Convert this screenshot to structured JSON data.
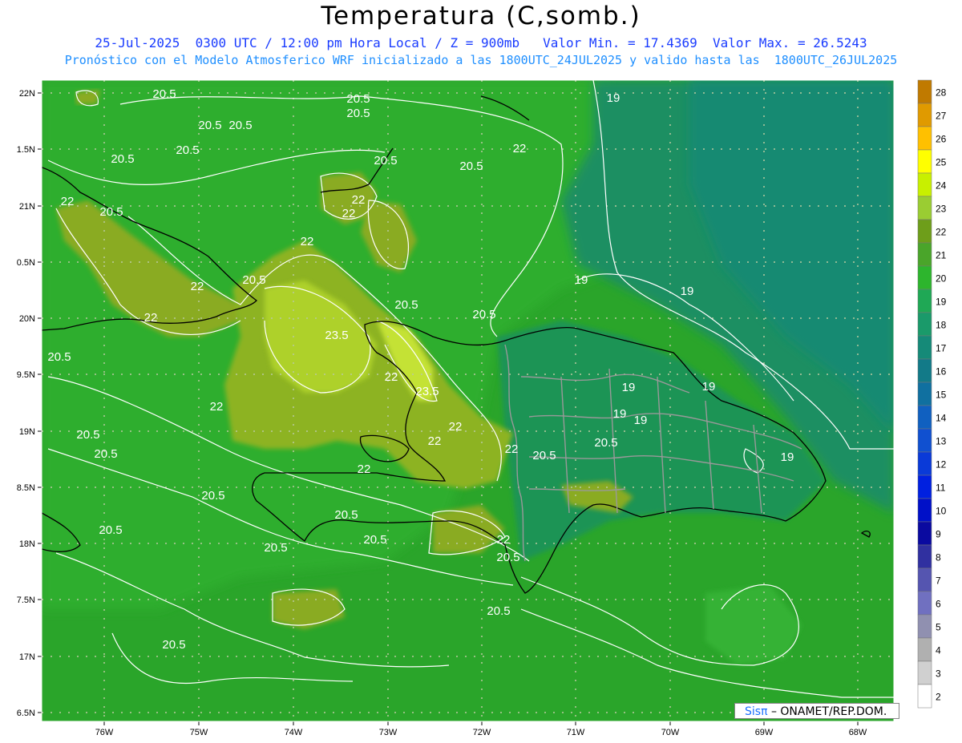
{
  "header": {
    "title": "Temperatura (C,somb.)",
    "line1": "25-Jul-2025  0300 UTC / 12:00 pm Hora Local / Z = 900mb   Valor Min. = 17.4369  Valor Max. = 26.5243",
    "line2": "Pronóstico con el Modelo Atmosferico WRF inicializado a las 1800UTC_24JUL2025 y valido hasta las  1800UTC_26JUL2025"
  },
  "axes": {
    "lat_labels": [
      "22N",
      "1.5N",
      "21N",
      "0.5N",
      "20N",
      "9.5N",
      "19N",
      "8.5N",
      "18N",
      "7.5N",
      "17N",
      "6.5N"
    ],
    "lon_labels": [
      "76W",
      "75W",
      "74W",
      "73W",
      "72W",
      "71W",
      "70W",
      "69W",
      "68W"
    ]
  },
  "colorbar": {
    "labels": [
      "28",
      "27",
      "26",
      "25",
      "24",
      "23",
      "22",
      "21",
      "20",
      "19",
      "18",
      "17",
      "16",
      "15",
      "14",
      "13",
      "12",
      "11",
      "10",
      "9",
      "8",
      "7",
      "6",
      "5",
      "4",
      "3",
      "2"
    ],
    "colors": [
      "#c07a00",
      "#e09a00",
      "#ffc000",
      "#ffff00",
      "#c8f000",
      "#9acd32",
      "#6e9e1a",
      "#4aa52a",
      "#2db52d",
      "#1fa855",
      "#1a9a6a",
      "#158a78",
      "#127a88",
      "#1070a0",
      "#1060c0",
      "#1050d0",
      "#0a3ad8",
      "#0020e0",
      "#0010c8",
      "#0a0aa0",
      "#3030a0",
      "#5555b0",
      "#7070c0",
      "#9090b0",
      "#b0b0b0",
      "#d0d0d0",
      "#ffffff"
    ]
  },
  "contour_labels": [
    {
      "text": "20.5"
    },
    {
      "text": "20.5"
    },
    {
      "text": "20.5"
    },
    {
      "text": "20.5"
    },
    {
      "text": "20.5"
    },
    {
      "text": "20.5"
    },
    {
      "text": "20.5"
    },
    {
      "text": "20.5"
    },
    {
      "text": "19"
    },
    {
      "text": "22"
    },
    {
      "text": "20.5"
    },
    {
      "text": "22"
    },
    {
      "text": "22"
    },
    {
      "text": "20.5"
    },
    {
      "text": "22"
    },
    {
      "text": "22"
    },
    {
      "text": "22"
    },
    {
      "text": "20.5"
    },
    {
      "text": "20.5"
    },
    {
      "text": "19"
    },
    {
      "text": "19"
    },
    {
      "text": "20.5"
    },
    {
      "text": "23.5"
    },
    {
      "text": "22"
    },
    {
      "text": "23.5"
    },
    {
      "text": "22"
    },
    {
      "text": "19"
    },
    {
      "text": "19"
    },
    {
      "text": "22"
    },
    {
      "text": "20.5"
    },
    {
      "text": "22"
    },
    {
      "text": "19"
    },
    {
      "text": "19"
    },
    {
      "text": "20.5"
    },
    {
      "text": "20.5"
    },
    {
      "text": "22"
    },
    {
      "text": "20.5"
    },
    {
      "text": "22"
    },
    {
      "text": "22"
    },
    {
      "text": "19"
    },
    {
      "text": "20.5"
    },
    {
      "text": "20.5"
    },
    {
      "text": "20.5"
    },
    {
      "text": "20.5"
    },
    {
      "text": "22"
    },
    {
      "text": "20.5"
    },
    {
      "text": "20.5"
    },
    {
      "text": "20.5"
    },
    {
      "text": "20.5"
    },
    {
      "text": "20.5"
    }
  ],
  "credit": {
    "sis": "Sisπ",
    "rest": "– ONAMET/REP.DOM."
  },
  "colors": {
    "ocean_green": "#2aa52a",
    "dark_green": "#1a8f3a",
    "teal": "#1a8a6a",
    "olive": "#8fb025",
    "lime": "#b6d630",
    "contour": "#ffffff",
    "coast": "#000000",
    "border": "#999999"
  }
}
